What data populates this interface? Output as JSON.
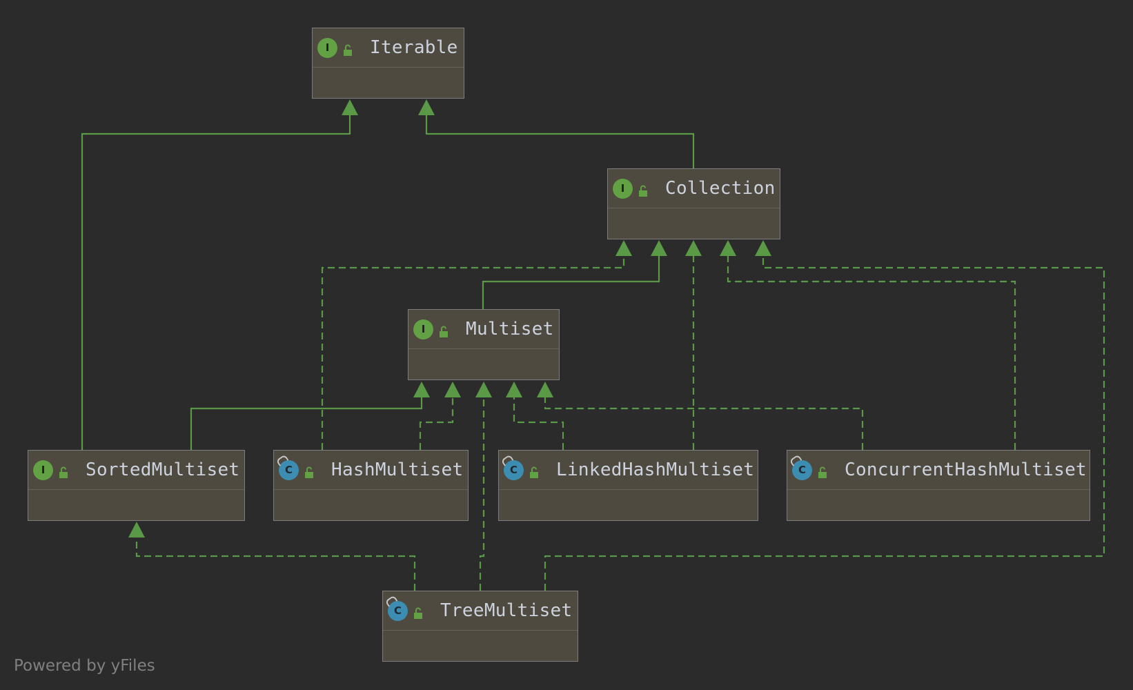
{
  "diagram": {
    "nodes": [
      {
        "id": "iterable",
        "name": "Iterable",
        "kind": "interface",
        "kind_letter": "I"
      },
      {
        "id": "collection",
        "name": "Collection",
        "kind": "interface",
        "kind_letter": "I"
      },
      {
        "id": "multiset",
        "name": "Multiset",
        "kind": "interface",
        "kind_letter": "I"
      },
      {
        "id": "sortedmultiset",
        "name": "SortedMultiset",
        "kind": "interface",
        "kind_letter": "I"
      },
      {
        "id": "hashmultiset",
        "name": "HashMultiset",
        "kind": "class",
        "kind_letter": "C"
      },
      {
        "id": "linkedhashmultiset",
        "name": "LinkedHashMultiset",
        "kind": "class",
        "kind_letter": "C"
      },
      {
        "id": "concurrenthashmultiset",
        "name": "ConcurrentHashMultiset",
        "kind": "class",
        "kind_letter": "C"
      },
      {
        "id": "treemultiset",
        "name": "TreeMultiset",
        "kind": "class",
        "kind_letter": "C"
      }
    ],
    "edges": [
      {
        "from": "sortedmultiset",
        "to": "iterable",
        "style": "solid"
      },
      {
        "from": "collection",
        "to": "iterable",
        "style": "solid"
      },
      {
        "from": "multiset",
        "to": "collection",
        "style": "solid"
      },
      {
        "from": "hashmultiset",
        "to": "collection",
        "style": "dashed"
      },
      {
        "from": "linkedhashmultiset",
        "to": "collection",
        "style": "dashed"
      },
      {
        "from": "concurrenthashmultiset",
        "to": "collection",
        "style": "dashed"
      },
      {
        "from": "treemultiset",
        "to": "collection",
        "style": "dashed"
      },
      {
        "from": "sortedmultiset",
        "to": "multiset",
        "style": "solid"
      },
      {
        "from": "hashmultiset",
        "to": "multiset",
        "style": "dashed"
      },
      {
        "from": "treemultiset",
        "to": "multiset",
        "style": "dashed"
      },
      {
        "from": "linkedhashmultiset",
        "to": "multiset",
        "style": "dashed"
      },
      {
        "from": "concurrenthashmultiset",
        "to": "multiset",
        "style": "dashed"
      },
      {
        "from": "treemultiset",
        "to": "sortedmultiset",
        "style": "dashed"
      }
    ],
    "colors": {
      "background": "#2b2b2b",
      "node_fill": "#4f4a40",
      "edge": "#5a9a46",
      "interface_icon": "#62a245",
      "class_icon": "#3c8db1"
    }
  },
  "footer": "Powered by yFiles"
}
